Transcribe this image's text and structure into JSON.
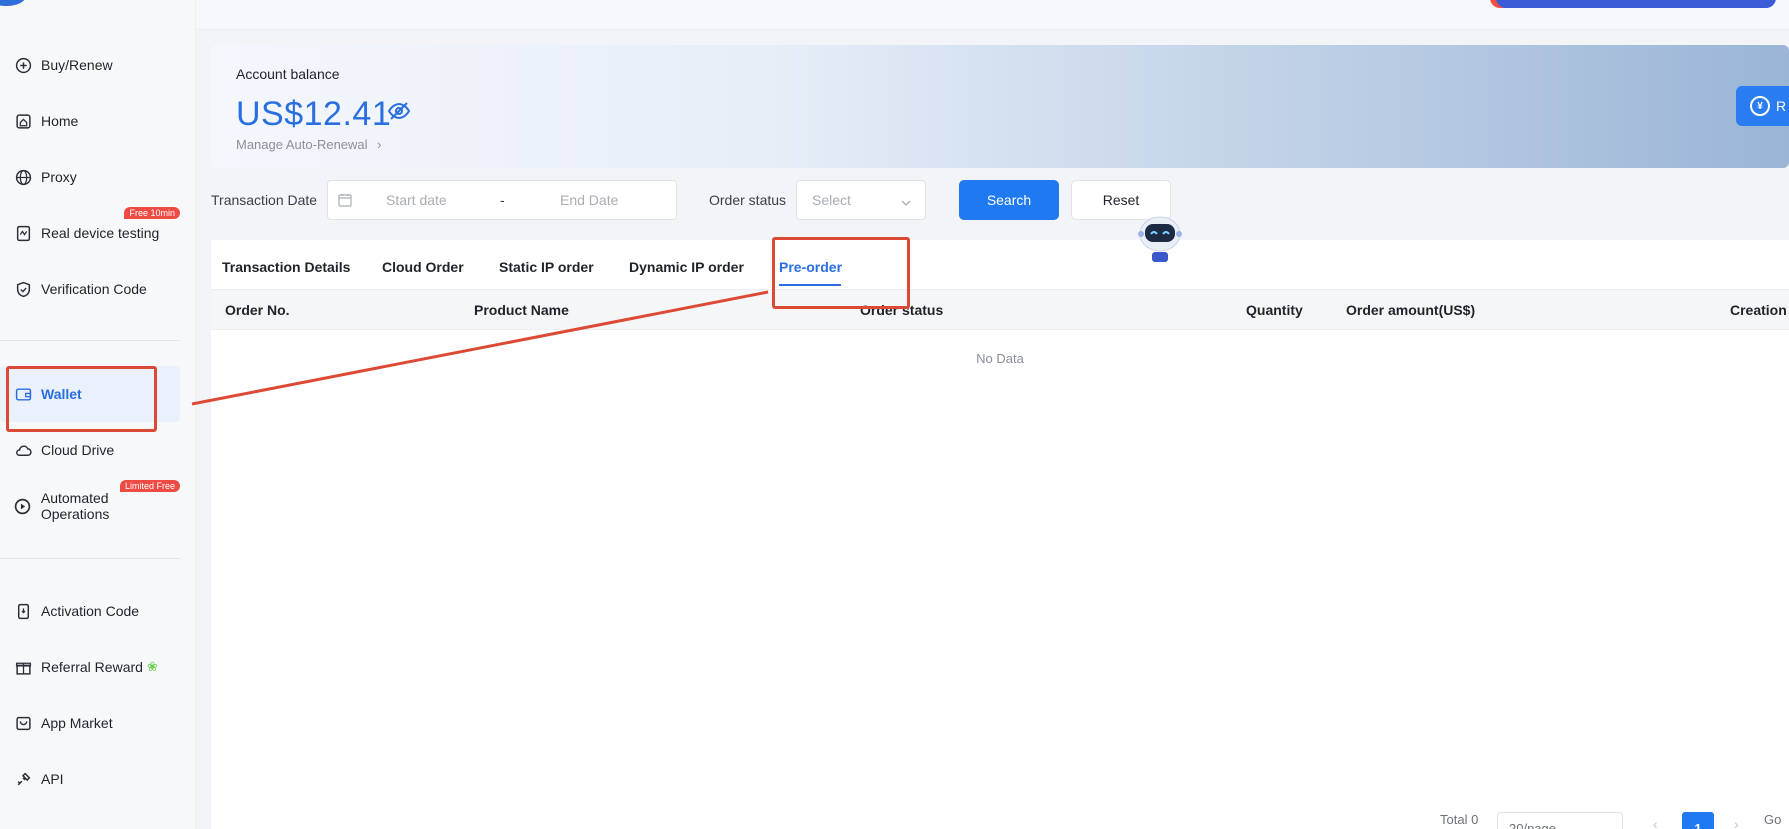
{
  "sidebar": {
    "items_top": [
      {
        "label": "Buy/Renew",
        "icon": "plus-circle-icon"
      },
      {
        "label": "Home",
        "icon": "home-icon"
      },
      {
        "label": "Proxy",
        "icon": "globe-icon"
      },
      {
        "label": "Real device testing",
        "icon": "device-test-icon",
        "badge": "Free 10min"
      },
      {
        "label": "Verification Code",
        "icon": "shield-check-icon"
      }
    ],
    "items_mid": [
      {
        "label": "Wallet",
        "icon": "wallet-icon",
        "active": true
      },
      {
        "label": "Cloud Drive",
        "icon": "cloud-icon"
      },
      {
        "label": "Automated Operations",
        "icon": "play-circle-icon",
        "badge": "Limited Free"
      }
    ],
    "items_bottom": [
      {
        "label": "Activation Code",
        "icon": "activation-code-icon"
      },
      {
        "label": "Referral Reward",
        "icon": "gift-icon"
      },
      {
        "label": "App Market",
        "icon": "app-market-icon"
      },
      {
        "label": "API",
        "icon": "api-icon"
      }
    ]
  },
  "balance": {
    "label": "Account balance",
    "amount": "US$12.41",
    "manage_link": "Manage Auto-Renewal",
    "recharge_label": "R"
  },
  "filters": {
    "date_label": "Transaction Date",
    "start_placeholder": "Start date",
    "separator": "-",
    "end_placeholder": "End Date",
    "status_label": "Order status",
    "status_placeholder": "Select",
    "search_label": "Search",
    "reset_label": "Reset"
  },
  "tabs": [
    {
      "label": "Transaction Details"
    },
    {
      "label": "Cloud Order"
    },
    {
      "label": "Static IP order"
    },
    {
      "label": "Dynamic IP order"
    },
    {
      "label": "Pre-order",
      "active": true
    }
  ],
  "table": {
    "columns": [
      "Order No.",
      "Product Name",
      "Order status",
      "Quantity",
      "Order amount(US$)",
      "Creation"
    ],
    "empty_text": "No Data"
  },
  "pagination": {
    "total_text": "Total 0",
    "page_size": "20/page",
    "current_page": "1",
    "goto_text": "Go"
  },
  "colors": {
    "accent": "#2a6fe0",
    "primary_button": "#1f7af2",
    "badge": "#ef4b45",
    "annotation": "#dc4a35"
  }
}
